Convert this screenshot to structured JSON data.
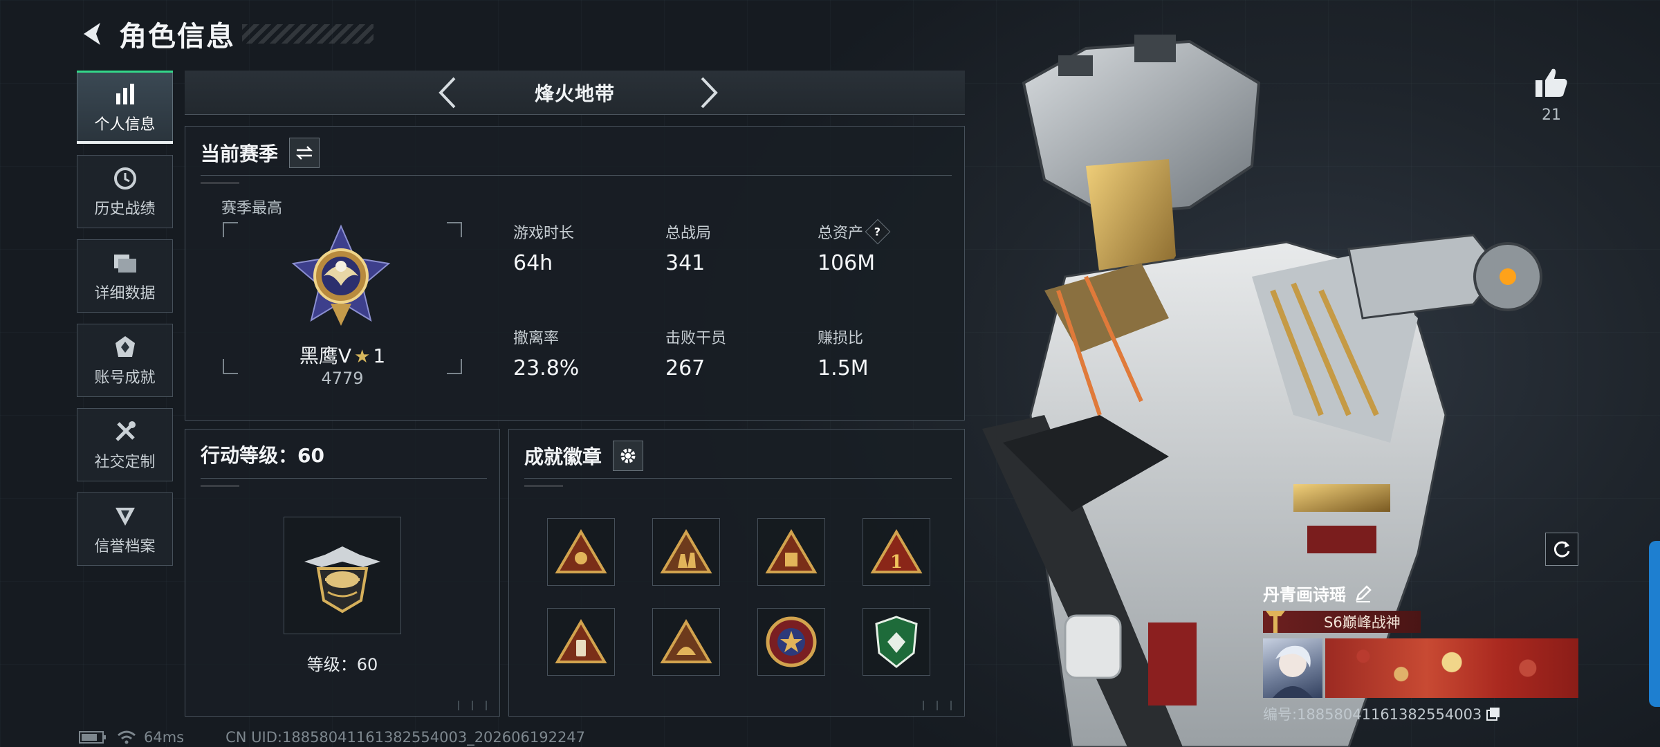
{
  "header": {
    "title": "角色信息"
  },
  "sidebar": {
    "items": [
      {
        "label": "个人信息",
        "icon": "bar-chart-icon",
        "active": true
      },
      {
        "label": "历史战绩",
        "icon": "history-clock-icon"
      },
      {
        "label": "详细数据",
        "icon": "folder-icon"
      },
      {
        "label": "账号成就",
        "icon": "achievement-icon"
      },
      {
        "label": "社交定制",
        "icon": "tools-icon"
      },
      {
        "label": "信誉档案",
        "icon": "credit-shield-icon"
      }
    ]
  },
  "mode": {
    "title": "烽火地带"
  },
  "season": {
    "title": "当前赛季",
    "subtitle": "赛季最高",
    "rank_name": "黑鹰V",
    "rank_stars": "1",
    "rank_score": "4779",
    "stats": [
      {
        "label": "游戏时长",
        "value": "64h"
      },
      {
        "label": "总战局",
        "value": "341"
      },
      {
        "label": "总资产",
        "value": "106M",
        "help": "?"
      },
      {
        "label": "撤离率",
        "value": "23.8%"
      },
      {
        "label": "击败干员",
        "value": "267"
      },
      {
        "label": "赚损比",
        "value": "1.5M"
      }
    ]
  },
  "level": {
    "title": "行动等级：60",
    "label": "等级：60"
  },
  "achievements": {
    "title": "成就徽章",
    "badges": [
      "triangle-emblem-icon",
      "triangle-soldiers-icon",
      "triangle-crate-icon",
      "triangle-number-one-icon",
      "triangle-canister-icon",
      "triangle-helmet-icon",
      "round-star-emblem-icon",
      "green-shield-emblem-icon"
    ]
  },
  "status": {
    "ping": "64ms",
    "uid": "CN UID:18858041161382554003_202606192247"
  },
  "profile": {
    "likes": "21",
    "name": "丹青画诗瑶",
    "title": "S6巅峰战神",
    "id_line": "编号:18858041161382554003"
  },
  "colors": {
    "accent": "#34d88a",
    "title_red": "#6c1f1f",
    "edge_blue": "#1e7fd0"
  }
}
